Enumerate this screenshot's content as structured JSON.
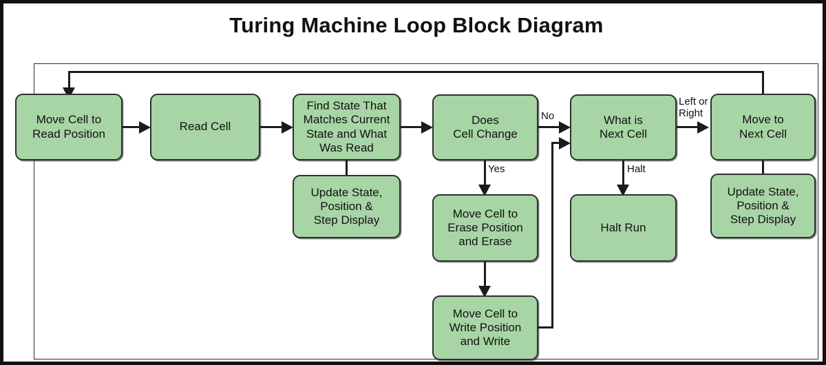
{
  "diagram": {
    "title": "Turing Machine Loop Block Diagram",
    "accent_color": "#a8d5a6",
    "border_color": "#2f2f2f",
    "line_color": "#1b1b1b",
    "nodes": [
      {
        "id": "move-read",
        "label": "Move Cell to\nRead Position"
      },
      {
        "id": "read-cell",
        "label": "Read Cell"
      },
      {
        "id": "find-state",
        "label": "Find State That\nMatches Current\nState and What\nWas Read"
      },
      {
        "id": "update-left",
        "label": "Update State,\nPosition &\nStep Display"
      },
      {
        "id": "does-change",
        "label": "Does\nCell Change"
      },
      {
        "id": "move-erase",
        "label": "Move Cell to\nErase Position\nand Erase"
      },
      {
        "id": "move-write",
        "label": "Move Cell to\nWrite Position\nand Write"
      },
      {
        "id": "next-cell-q",
        "label": "What is\nNext Cell"
      },
      {
        "id": "halt-run",
        "label": "Halt Run"
      },
      {
        "id": "move-next",
        "label": "Move to\nNext Cell"
      },
      {
        "id": "update-right",
        "label": "Update State,\nPosition &\nStep Display"
      }
    ],
    "edge_labels": {
      "no": "No",
      "yes": "Yes",
      "halt": "Halt",
      "left_or_right": "Left or\nRight"
    }
  },
  "chart_data": {
    "type": "diagram",
    "title": "Turing Machine Loop Block Diagram",
    "nodes": [
      "Move Cell to Read Position",
      "Read Cell",
      "Find State That Matches Current State and What Was Read",
      "Update State, Position & Step Display",
      "Does Cell Change",
      "Move Cell to Erase Position and Erase",
      "Move Cell to Write Position and Write",
      "What is Next Cell",
      "Halt Run",
      "Move to Next Cell",
      "Update State, Position & Step Display"
    ],
    "edges": [
      {
        "from": "Move Cell to Read Position",
        "to": "Read Cell",
        "label": ""
      },
      {
        "from": "Read Cell",
        "to": "Find State That Matches Current State and What Was Read",
        "label": ""
      },
      {
        "from": "Find State That Matches Current State and What Was Read",
        "to": "Update State, Position & Step Display",
        "label": ""
      },
      {
        "from": "Find State That Matches Current State and What Was Read",
        "to": "Does Cell Change",
        "label": ""
      },
      {
        "from": "Does Cell Change",
        "to": "Move Cell to Erase Position and Erase",
        "label": "Yes"
      },
      {
        "from": "Does Cell Change",
        "to": "What is Next Cell",
        "label": "No"
      },
      {
        "from": "Move Cell to Erase Position and Erase",
        "to": "Move Cell to Write Position and Write",
        "label": ""
      },
      {
        "from": "Move Cell to Write Position and Write",
        "to": "What is Next Cell",
        "label": ""
      },
      {
        "from": "What is Next Cell",
        "to": "Halt Run",
        "label": "Halt"
      },
      {
        "from": "What is Next Cell",
        "to": "Move to Next Cell",
        "label": "Left or Right"
      },
      {
        "from": "Move to Next Cell",
        "to": "Update State, Position & Step Display",
        "label": ""
      },
      {
        "from": "Move to Next Cell",
        "to": "Move Cell to Read Position",
        "label": ""
      }
    ]
  }
}
